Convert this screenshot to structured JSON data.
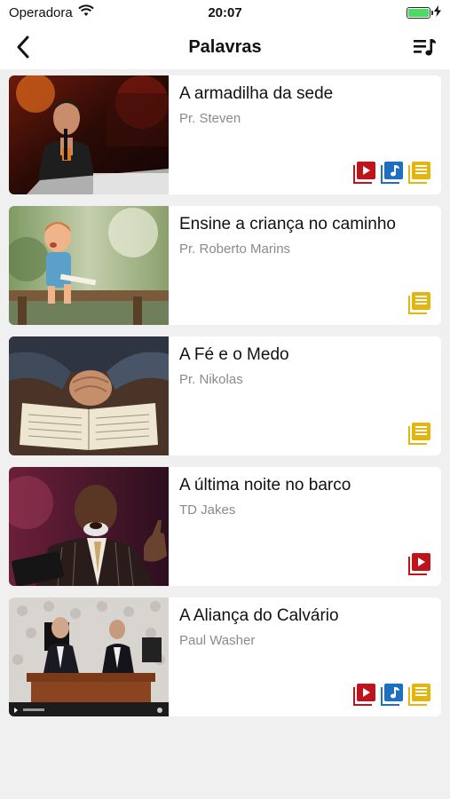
{
  "status_bar": {
    "carrier": "Operadora",
    "time": "20:07"
  },
  "nav": {
    "title": "Palavras"
  },
  "colors": {
    "video": "#c0141c",
    "audio": "#1d6fbf",
    "text": "#e5b50f"
  },
  "sermons": [
    {
      "title": "A armadilha da sede",
      "author": "Pr. Steven",
      "icons": [
        "video-icon",
        "audio-icon",
        "text-icon"
      ]
    },
    {
      "title": "Ensine a criança no caminho",
      "author": "Pr. Roberto Marins",
      "icons": [
        "text-icon"
      ]
    },
    {
      "title": "A Fé e o Medo",
      "author": "Pr. Nikolas",
      "icons": [
        "text-icon"
      ]
    },
    {
      "title": "A última noite no barco",
      "author": "TD Jakes",
      "icons": [
        "video-icon"
      ]
    },
    {
      "title": "A Aliança do Calvário",
      "author": "Paul Washer",
      "icons": [
        "video-icon",
        "audio-icon",
        "text-icon"
      ]
    }
  ]
}
